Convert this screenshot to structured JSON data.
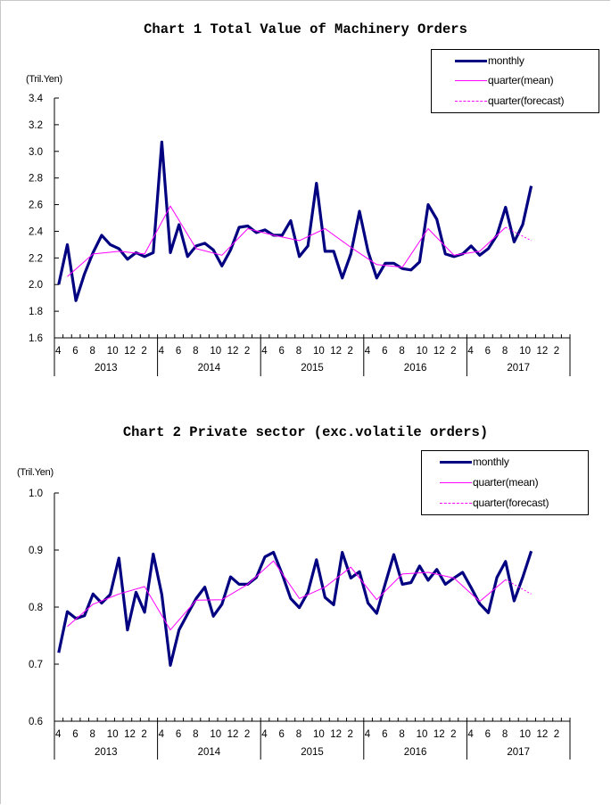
{
  "chart_data": [
    {
      "type": "line",
      "title": "Chart 1 Total Value of Machinery Orders",
      "ylabel": "(Tril.Yen)",
      "ylim": [
        1.6,
        3.4
      ],
      "yticks": [
        "1.6",
        "1.8",
        "2.0",
        "2.2",
        "2.4",
        "2.6",
        "2.8",
        "3.0",
        "3.2",
        "3.4"
      ],
      "xlabel": "",
      "x_month_ticks": [
        "4",
        "6",
        "8",
        "10",
        "12",
        "2"
      ],
      "x_years": [
        "2013",
        "2014",
        "2015",
        "2016",
        "2017"
      ],
      "grid": false,
      "legend": {
        "placement": "top-right",
        "entries": [
          "monthly",
          "quarter(mean)",
          "quarter(forecast)"
        ]
      },
      "series": [
        {
          "name": "monthly",
          "color": "#000080",
          "start": "2013-04",
          "values": [
            2.0,
            2.3,
            1.88,
            2.08,
            2.24,
            2.37,
            2.3,
            2.27,
            2.19,
            2.24,
            2.21,
            2.24,
            3.07,
            2.24,
            2.45,
            2.21,
            2.29,
            2.31,
            2.26,
            2.14,
            2.26,
            2.43,
            2.44,
            2.39,
            2.41,
            2.37,
            2.37,
            2.48,
            2.21,
            2.29,
            2.76,
            2.25,
            2.25,
            2.05,
            2.23,
            2.55,
            2.25,
            2.05,
            2.16,
            2.16,
            2.12,
            2.11,
            2.17,
            2.6,
            2.49,
            2.23,
            2.21,
            2.23,
            2.29,
            2.22,
            2.27,
            2.37,
            2.58,
            2.32,
            2.45,
            2.74
          ]
        },
        {
          "name": "quarter(mean)",
          "color": "#ff00ff",
          "points_at_month_index": [
            1,
            4,
            7,
            10,
            13,
            16,
            19,
            22,
            25,
            28,
            31,
            34,
            37,
            40,
            43,
            46,
            49,
            52
          ],
          "values": [
            2.06,
            2.23,
            2.25,
            2.23,
            2.59,
            2.27,
            2.22,
            2.42,
            2.37,
            2.33,
            2.42,
            2.28,
            2.15,
            2.13,
            2.42,
            2.22,
            2.25,
            2.43
          ]
        },
        {
          "name": "quarter(forecast)",
          "color": "#ff00ff",
          "dashed": true,
          "points_at_month_index": [
            52,
            55
          ],
          "values": [
            2.43,
            2.33
          ]
        }
      ]
    },
    {
      "type": "line",
      "title": "Chart 2 Private sector (exc.volatile orders)",
      "ylabel": "(Tril.Yen)",
      "ylim": [
        0.6,
        1.0
      ],
      "yticks": [
        "0.6",
        "0.7",
        "0.8",
        "0.9",
        "1.0"
      ],
      "xlabel": "",
      "x_month_ticks": [
        "4",
        "6",
        "8",
        "10",
        "12",
        "2"
      ],
      "x_years": [
        "2013",
        "2014",
        "2015",
        "2016",
        "2017"
      ],
      "grid": false,
      "legend": {
        "placement": "top-right",
        "entries": [
          "monthly",
          "quarter(mean)",
          "quarter(forecast)"
        ]
      },
      "series": [
        {
          "name": "monthly",
          "color": "#000080",
          "start": "2013-04",
          "values": [
            0.72,
            0.792,
            0.78,
            0.785,
            0.823,
            0.807,
            0.822,
            0.886,
            0.76,
            0.826,
            0.791,
            0.893,
            0.822,
            0.698,
            0.76,
            0.788,
            0.815,
            0.835,
            0.784,
            0.805,
            0.853,
            0.84,
            0.84,
            0.852,
            0.888,
            0.896,
            0.858,
            0.815,
            0.799,
            0.826,
            0.883,
            0.817,
            0.804,
            0.896,
            0.851,
            0.862,
            0.807,
            0.789,
            0.841,
            0.892,
            0.84,
            0.843,
            0.872,
            0.847,
            0.866,
            0.84,
            0.851,
            0.861,
            0.834,
            0.806,
            0.79,
            0.852,
            0.88,
            0.811,
            0.852,
            0.898
          ]
        },
        {
          "name": "quarter(mean)",
          "color": "#ff00ff",
          "points_at_month_index": [
            1,
            4,
            7,
            10,
            13,
            16,
            19,
            22,
            25,
            28,
            31,
            34,
            37,
            40,
            43,
            46,
            49,
            52
          ],
          "values": [
            0.766,
            0.805,
            0.823,
            0.836,
            0.76,
            0.812,
            0.813,
            0.84,
            0.881,
            0.815,
            0.835,
            0.87,
            0.813,
            0.858,
            0.861,
            0.851,
            0.81,
            0.848
          ]
        },
        {
          "name": "quarter(forecast)",
          "color": "#ff00ff",
          "dashed": true,
          "points_at_month_index": [
            52,
            55
          ],
          "values": [
            0.848,
            0.823
          ]
        }
      ]
    }
  ]
}
